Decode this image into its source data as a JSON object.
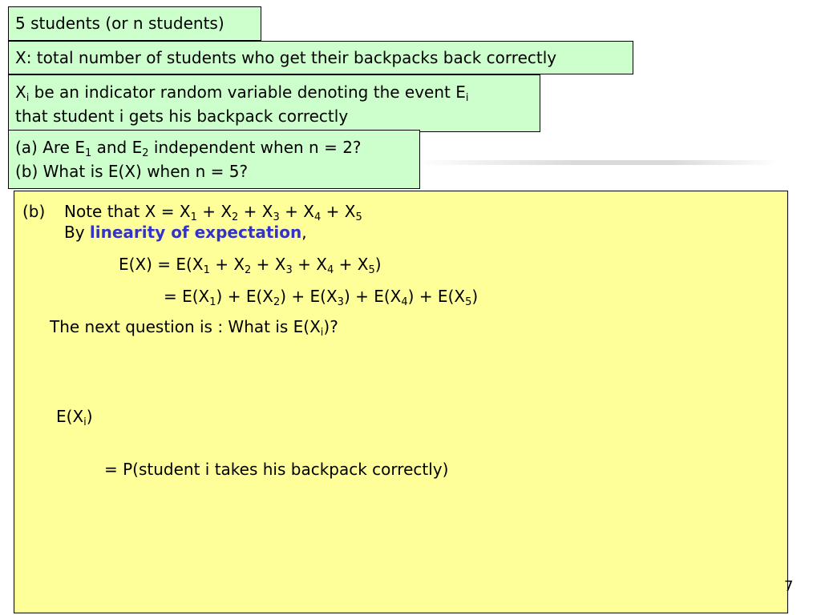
{
  "boxes": {
    "box1": "5 students (or n students)",
    "box2": "X: total number of students who get their backpacks back correctly",
    "box3": {
      "var": "X",
      "var_sub": "i",
      "line1_mid": " be an indicator random variable denoting the event E",
      "line1_sub": "i",
      "line2": "that student i gets his backpack correctly"
    },
    "box4": {
      "line1_a": "(a) Are E",
      "line1_sub1": "1",
      "line1_b": " and E",
      "line1_sub2": "2",
      "line1_c": " independent when n = 2?",
      "line2": "(b) What is E(X) when n = 5?"
    }
  },
  "solution": {
    "label": "(b)",
    "note_prefix": "Note that   X = X",
    "plus": " + X",
    "subs": [
      "1",
      "2",
      "3",
      "4",
      "5"
    ],
    "by_prefix": "By ",
    "linearity": "linearity of expectation",
    "comma": ",",
    "ex_prefix": "E(X) = E(X",
    "close_paren": ")",
    "sum_prefix": "= E(X",
    "sum_plus": ") + E(X",
    "next_question_a": "The next question is : What is E(X",
    "next_question_sub": "i",
    "next_question_b": ")?",
    "exi_a": "E(X",
    "exi_sub": "i",
    "exi_b": ")",
    "prob": "= P(student i takes his backpack correctly)"
  },
  "page_number": "7"
}
